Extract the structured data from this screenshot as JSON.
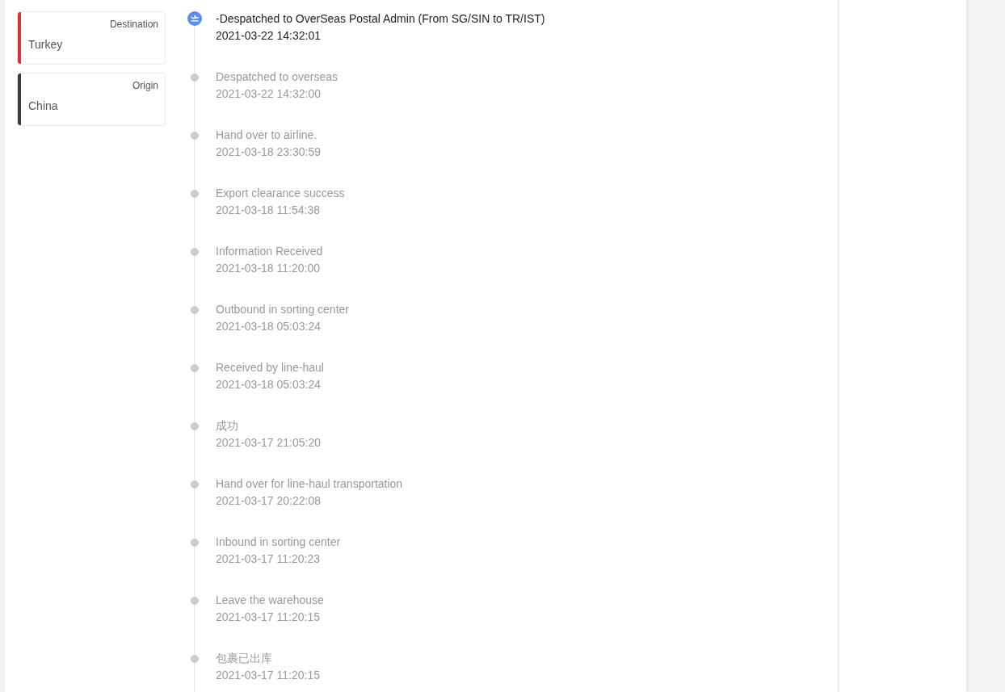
{
  "route_cards": [
    {
      "label": "Destination",
      "value": "Turkey",
      "color": "#dc3232"
    },
    {
      "label": "Origin",
      "value": "China",
      "color": "#3c3c3c"
    }
  ],
  "events": [
    {
      "description": "-Despatched to OverSeas Postal Admin (From SG/SIN to TR/IST)",
      "time": "2021-03-22 14:32:01",
      "active": true
    },
    {
      "description": "Despatched  to overseas",
      "time": "2021-03-22 14:32:00",
      "active": false
    },
    {
      "description": "Hand over to airline.",
      "time": "2021-03-18 23:30:59",
      "active": false
    },
    {
      "description": "Export clearance success",
      "time": "2021-03-18 11:54:38",
      "active": false
    },
    {
      "description": "Information Received",
      "time": "2021-03-18 11:20:00",
      "active": false
    },
    {
      "description": "Outbound in sorting center",
      "time": "2021-03-18 05:03:24",
      "active": false
    },
    {
      "description": "Received by line-haul",
      "time": "2021-03-18 05:03:24",
      "active": false
    },
    {
      "description": "成功",
      "time": "2021-03-17 21:05:20",
      "active": false
    },
    {
      "description": "Hand over for line-haul transportation",
      "time": "2021-03-17 20:22:08",
      "active": false
    },
    {
      "description": "Inbound in sorting center",
      "time": "2021-03-17 11:20:23",
      "active": false
    },
    {
      "description": "Leave the warehouse",
      "time": "2021-03-17 11:20:15",
      "active": false
    },
    {
      "description": "包裹已出库",
      "time": "2021-03-17 11:20:15",
      "active": false
    }
  ]
}
